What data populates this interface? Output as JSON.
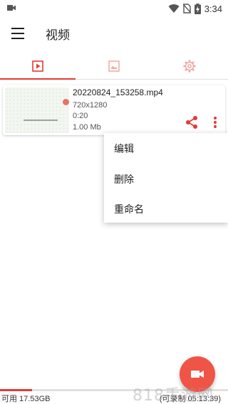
{
  "statusbar": {
    "time": "3:34"
  },
  "appbar": {
    "title": "视频"
  },
  "tabs": [
    {
      "icon": "video-icon",
      "active": true
    },
    {
      "icon": "image-icon",
      "active": false
    },
    {
      "icon": "settings-icon",
      "active": false
    }
  ],
  "videos": [
    {
      "filename": "20220824_153258.mp4",
      "resolution": "720x1280",
      "duration": "0:20",
      "size": "1.00 Mb"
    }
  ],
  "context_menu": {
    "items": [
      "编辑",
      "删除",
      "重命名"
    ]
  },
  "footer": {
    "storage": "可用 17.53GB",
    "remaining": "(可录制 05:13:39)",
    "usage_fraction": 0.14
  },
  "fab": {
    "icon": "record-camera-icon"
  },
  "watermark": "818手游网",
  "colors": {
    "accent": "#e53935",
    "fab": "#ef5446"
  }
}
